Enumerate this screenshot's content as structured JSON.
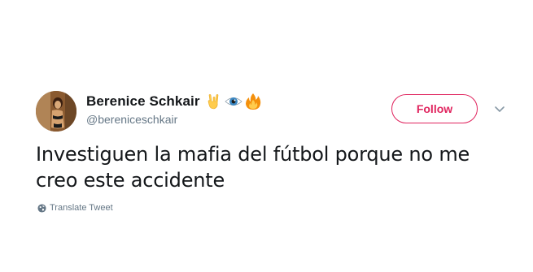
{
  "author": {
    "display_name": "Berenice Schkair",
    "handle": "@bereniceschkair",
    "emojis": [
      "rock-on-hand-icon",
      "eye-icon",
      "fire-icon"
    ]
  },
  "actions": {
    "follow_label": "Follow"
  },
  "tweet": {
    "text": "Investiguen la mafia del fútbol porque no me creo este accidente",
    "translate_label": "Translate Tweet"
  },
  "colors": {
    "follow_accent": "#e0245e",
    "secondary_text": "#657786",
    "primary_text": "#14171a"
  }
}
